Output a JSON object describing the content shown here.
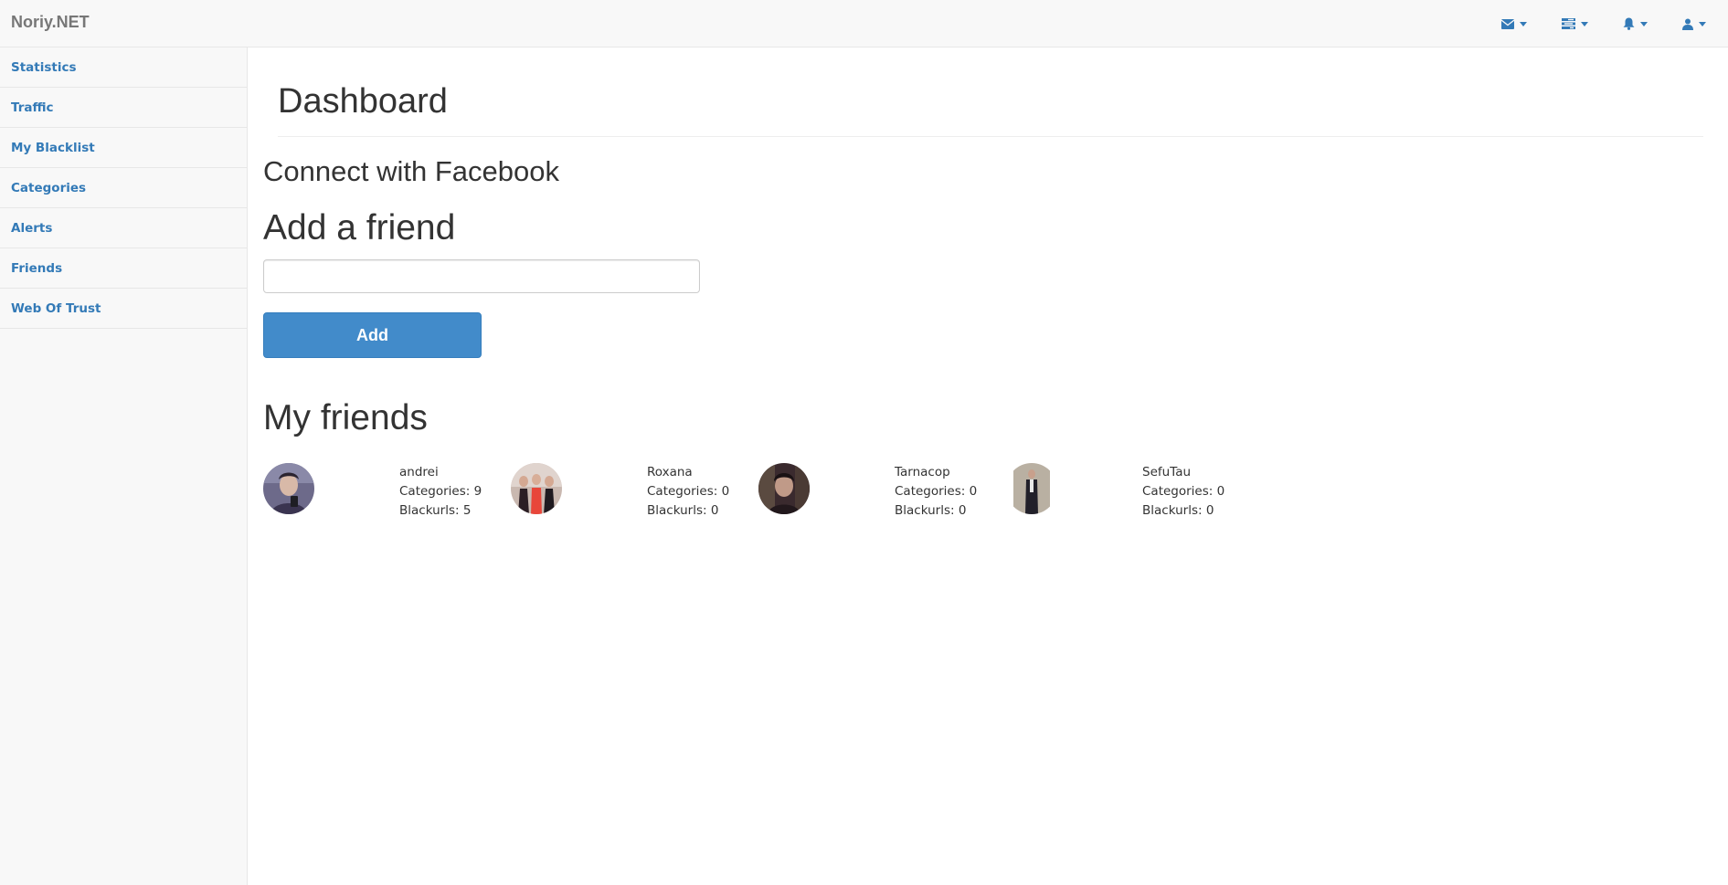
{
  "brand": "Noriy.NET",
  "navbar": {
    "icons": [
      "envelope-icon",
      "tasks-icon",
      "bell-icon",
      "user-icon"
    ]
  },
  "sidebar": {
    "items": [
      {
        "label": "Statistics"
      },
      {
        "label": "Traffic"
      },
      {
        "label": "My Blacklist"
      },
      {
        "label": "Categories"
      },
      {
        "label": "Alerts"
      },
      {
        "label": "Friends"
      },
      {
        "label": "Web Of Trust"
      }
    ]
  },
  "main": {
    "title": "Dashboard",
    "facebook_heading": "Connect with Facebook",
    "add_friend_heading": "Add a friend",
    "add_friend_input": {
      "value": "",
      "placeholder": ""
    },
    "add_button": "Add",
    "friends_heading": "My friends",
    "friends": [
      {
        "name": "andrei",
        "categories": "Categories: 9",
        "blackurls": "Blackurls: 5"
      },
      {
        "name": "Roxana",
        "categories": "Categories: 0",
        "blackurls": "Blackurls: 0"
      },
      {
        "name": "Tarnacop",
        "categories": "Categories: 0",
        "blackurls": "Blackurls: 0"
      },
      {
        "name": "SefuTau",
        "categories": "Categories: 0",
        "blackurls": "Blackurls: 0"
      }
    ]
  },
  "colors": {
    "link": "#337ab7",
    "primary_button": "#428bca",
    "navbar_bg": "#f8f8f8"
  }
}
